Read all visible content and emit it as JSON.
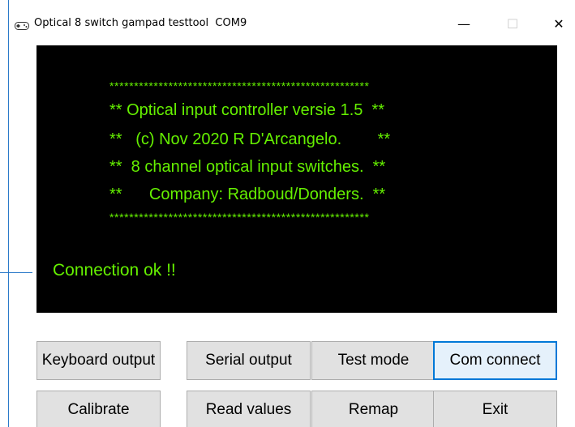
{
  "window": {
    "title": "Optical 8 switch gampad testtool  COM9",
    "minimize_glyph": "—",
    "maximize_glyph": "☐",
    "close_glyph": "✕",
    "app_icon": "gamepad-icon"
  },
  "console": {
    "lines": [
      "*****************************************************",
      "** Optical input controller versie 1.5  **",
      "**   (c) Nov 2020 R D'Arcangelo.        **",
      "**  8 channel optical input switches.  **",
      "**      Company: Radboud/Donders.  **",
      "*****************************************************"
    ],
    "status": "Connection ok !!",
    "text_color": "#65f000",
    "background_color": "#000000"
  },
  "buttons": {
    "keyboard_output": "Keyboard output",
    "serial_output": "Serial output",
    "test_mode": "Test mode",
    "com_connect": "Com connect",
    "calibrate": "Calibrate",
    "read_values": "Read values",
    "remap": "Remap",
    "exit": "Exit"
  }
}
